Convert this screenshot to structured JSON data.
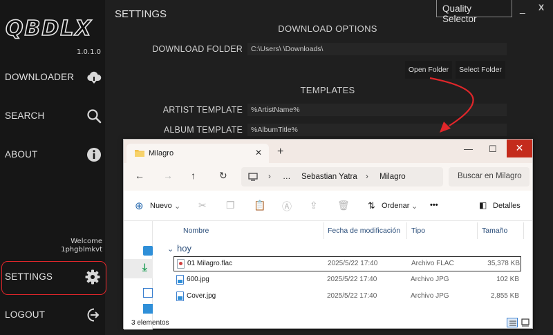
{
  "app": {
    "logo": "QBDLX",
    "version": "1.0.1.0",
    "nav": [
      {
        "label": "DOWNLOADER",
        "icon": "cloud-download-icon"
      },
      {
        "label": "SEARCH",
        "icon": "search-icon"
      },
      {
        "label": "ABOUT",
        "icon": "info-icon"
      },
      {
        "label": "SETTINGS",
        "icon": "gear-icon"
      },
      {
        "label": "LOGOUT",
        "icon": "logout-icon"
      }
    ],
    "welcome_line1": "Welcome",
    "welcome_line2": "1phgblmkvt",
    "highlight_color": "#e0262a"
  },
  "settings": {
    "title": "SETTINGS",
    "quality_selector": "Quality Selector",
    "window_min": "_",
    "window_close": "X",
    "download_options_heading": "DOWNLOAD OPTIONS",
    "download_folder_label": "DOWNLOAD FOLDER",
    "download_folder_value": "C:\\Users\\           \\Downloads\\",
    "open_folder": "Open Folder",
    "select_folder": "Select Folder",
    "templates_heading": "TEMPLATES",
    "artist_template_label": "ARTIST TEMPLATE",
    "artist_template_value": "%ArtistName%",
    "album_template_label": "ALBUM TEMPLATE",
    "album_template_value": "%AlbumTitle%"
  },
  "explorer": {
    "tab_title": "Milagro",
    "tab_close": "✕",
    "new_tab": "+",
    "minimize": "—",
    "maximize": "☐",
    "close": "✕",
    "breadcrumb": [
      "…",
      "Sebastian Yatra",
      "Milagro"
    ],
    "search_placeholder": "Buscar en Milagro",
    "toolbar": {
      "new": "Nuevo",
      "sort": "Ordenar",
      "more": "•••",
      "details": "Detalles"
    },
    "columns": {
      "name": "Nombre",
      "modified": "Fecha de modificación",
      "type": "Tipo",
      "size": "Tamaño"
    },
    "group": "hoy",
    "files": [
      {
        "name": "01 Milagro.flac",
        "modified": "2025/5/22 17:40",
        "type": "Archivo FLAC",
        "size": "35,378 KB",
        "selected": true
      },
      {
        "name": "600.jpg",
        "modified": "2025/5/22 17:40",
        "type": "Archivo JPG",
        "size": "102 KB",
        "selected": false
      },
      {
        "name": "Cover.jpg",
        "modified": "2025/5/22 17:40",
        "type": "Archivo JPG",
        "size": "2,855 KB",
        "selected": false
      }
    ],
    "status": "3 elementos"
  }
}
